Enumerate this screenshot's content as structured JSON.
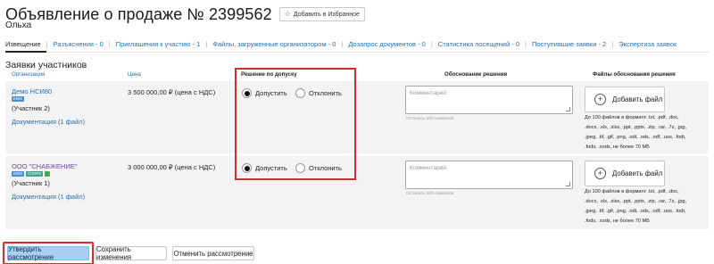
{
  "header": {
    "title": "Объявление о продаже № 2399562",
    "favorite_label": "Добавить в Избранное",
    "company": "Ольха"
  },
  "tabs": [
    "Извещение",
    "Разъяснения - 0",
    "Приглашения к участию - 1",
    "Файлы, загруженные организатором - 0",
    "Дозапрос документов - 0",
    "Статистика посещений - 0",
    "Поступившие заявки - 2",
    "Экспертиза заявок"
  ],
  "section_title": "Заявки участников",
  "columns": {
    "org": "Организация",
    "price": "Цена",
    "decision": "Решение по допуску",
    "reason": "Обоснование решения",
    "files": "Файлы обоснования решения"
  },
  "rows": [
    {
      "org": "Демо НСИ80",
      "badges": [
        "ЕВМ"
      ],
      "participant": "(Участник 2)",
      "docs": "Документация (1 файл)",
      "price": "3 500 000,00 ₽ (цена с НДС)",
      "decision": "admit"
    },
    {
      "org": "ООО \"СНАБЖЕНИЕ\"",
      "badges": [
        "ЕВМ",
        "СПИРК",
        ""
      ],
      "participant": "(Участник 1)",
      "docs": "Документация (1 файл)",
      "price": "3 000 000,00 ₽ (цена с НДС)",
      "decision": "admit"
    }
  ],
  "radio": {
    "admit": "Допустить",
    "reject": "Отклонить"
  },
  "comment": {
    "placeholder": "Комментарий:",
    "hint": "Осталось 500 символов"
  },
  "add_file_label": "Добавить файл",
  "file_note": "До 100 файлов в формате .txt, .pdf, .doc, .docx, .xls, .xlsx, .ppt, .pptx, .zip, .rar, .7z, .jpg, .jpeg, .tif, .gif, .png, .odt, .ods, .odf, .uos, .fodt, .fods, .xods, не более 70 МБ",
  "buttons": {
    "approve": "Утвердить рассмотрение",
    "save": "Сохранить изменения",
    "cancel": "Отменить рассмотрение"
  },
  "colors": {
    "link": "#1f6fb5",
    "highlight": "#d62b2b",
    "primary_button": "#a7d0f3",
    "row_bg": "#f3f3f3"
  }
}
